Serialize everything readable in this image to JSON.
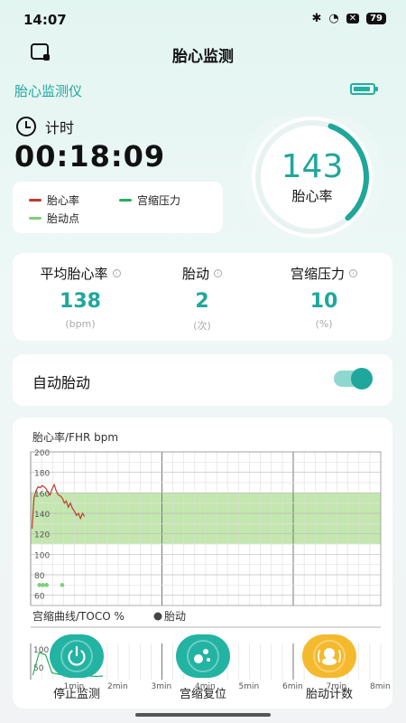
{
  "status_bar": {
    "time": "14:07",
    "icons": [
      "bluetooth-icon",
      "wifi-icon",
      "close-box-icon"
    ],
    "battery": "79"
  },
  "nav": {
    "title": "胎心监测"
  },
  "device": {
    "name": "胎心监测仪",
    "battery_level": 0.8
  },
  "timer": {
    "label": "计时",
    "value": "00:18:09"
  },
  "legend": [
    {
      "label": "胎心率",
      "color": "#c0392b"
    },
    {
      "label": "宫缩压力",
      "color": "#27ae60"
    },
    {
      "label": "胎动点",
      "color": "#7dcf7d"
    }
  ],
  "heart_rate": {
    "value": "143",
    "label": "胎心率",
    "progress": 0.6
  },
  "stats": [
    {
      "title": "平均胎心率",
      "value": "138",
      "unit": "(bpm)"
    },
    {
      "title": "胎动",
      "value": "2",
      "unit": "(次)"
    },
    {
      "title": "宫缩压力",
      "value": "10",
      "unit": "(%)"
    }
  ],
  "auto_fetal": {
    "label": "自动胎动",
    "enabled": true
  },
  "fhr_chart": {
    "title": "胎心率/FHR bpm",
    "y_ticks": [
      "200",
      "180",
      "160",
      "140",
      "120",
      "100",
      "80",
      "60"
    ],
    "normal_band": [
      110,
      160
    ],
    "ylim": [
      50,
      200
    ],
    "x_range_min": [
      0,
      8
    ],
    "fhr_values": [
      125,
      155,
      162,
      166,
      165,
      167,
      166,
      164,
      160,
      158,
      164,
      168,
      162,
      158,
      157,
      155,
      150,
      152,
      146,
      150,
      145,
      142,
      138,
      140,
      135,
      140,
      137
    ],
    "movement_points": [
      {
        "t": 0.2,
        "dots": 3
      },
      {
        "t": 0.72,
        "dots": 1
      }
    ]
  },
  "toco_chart": {
    "title": "宫缩曲线/TOCO %",
    "legend_label": "胎动",
    "y_ticks": [
      "100",
      "50"
    ],
    "x_ticks": [
      "1min",
      "2min",
      "3min",
      "4min",
      "5min",
      "6min",
      "7min",
      "8min"
    ],
    "toco_values": [
      10,
      60,
      55,
      15,
      12,
      10,
      8,
      9,
      10,
      8,
      7,
      8
    ]
  },
  "controls": [
    {
      "label": "停止监测",
      "color": "#22b3a3",
      "icon": "power-icon"
    },
    {
      "label": "宫缩复位",
      "color": "#22b3a3",
      "icon": "reset-icon"
    },
    {
      "label": "胎动计数",
      "color": "#f5b92e",
      "icon": "baby-icon"
    }
  ]
}
